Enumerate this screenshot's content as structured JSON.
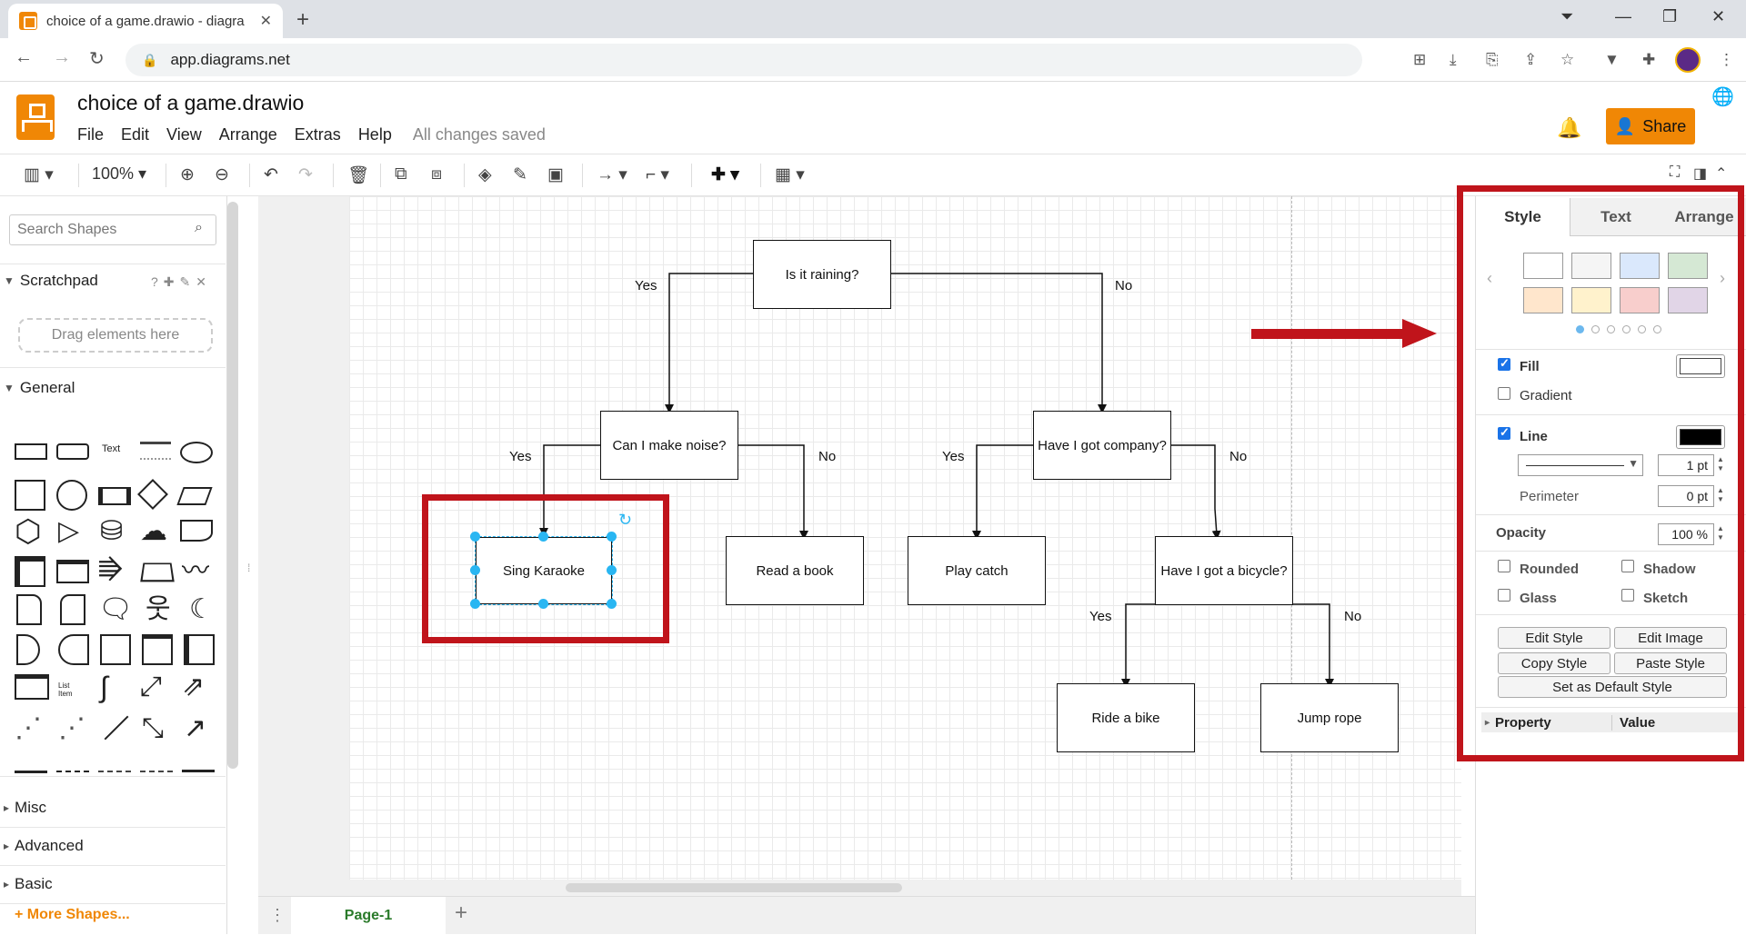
{
  "browser": {
    "tab_title": "choice of a game.drawio - diagra",
    "url": "app.diagrams.net"
  },
  "app": {
    "doc_title": "choice of a game.drawio",
    "menu": [
      "File",
      "Edit",
      "View",
      "Arrange",
      "Extras",
      "Help"
    ],
    "save_status": "All changes saved",
    "share_label": "Share"
  },
  "toolbar": {
    "zoom": "100%"
  },
  "sidebar": {
    "search_placeholder": "Search Shapes",
    "scratchpad": "Scratchpad",
    "drag_hint": "Drag elements here",
    "general": "General",
    "shape_text_label": "Text",
    "list_item_label": "List Item",
    "sections": [
      "Misc",
      "Advanced",
      "Basic"
    ],
    "more_shapes": "+ More Shapes..."
  },
  "diagram": {
    "nodes": {
      "raining": "Is it raining?",
      "noise": "Can I make noise?",
      "company": "Have I got company?",
      "karaoke": "Sing Karaoke",
      "book": "Read a book",
      "catch": "Play catch",
      "bicycle": "Have I got a bicycle?",
      "bike": "Ride a bike",
      "rope": "Jump rope"
    },
    "edge_labels": {
      "raining_yes": "Yes",
      "raining_no": "No",
      "noise_yes": "Yes",
      "noise_no": "No",
      "company_yes": "Yes",
      "company_no": "No",
      "bicycle_yes": "Yes",
      "bicycle_no": "No"
    }
  },
  "pages": {
    "active": "Page-1"
  },
  "format_panel": {
    "tabs": [
      "Style",
      "Text",
      "Arrange"
    ],
    "swatch_colors": [
      "#ffffff",
      "#f5f5f5",
      "#dae8fc",
      "#d5e8d4",
      "#ffe6cc",
      "#fff2cc",
      "#f8cecc",
      "#e1d5e7"
    ],
    "fill": "Fill",
    "gradient": "Gradient",
    "line": "Line",
    "line_width": "1 pt",
    "perimeter": "Perimeter",
    "perimeter_value": "0 pt",
    "opacity": "Opacity",
    "opacity_value": "100 %",
    "rounded": "Rounded",
    "shadow": "Shadow",
    "glass": "Glass",
    "sketch": "Sketch",
    "edit_style": "Edit Style",
    "edit_image": "Edit Image",
    "copy_style": "Copy Style",
    "paste_style": "Paste Style",
    "set_default": "Set as Default Style",
    "property": "Property",
    "value": "Value",
    "fill_checked": true,
    "gradient_checked": false,
    "line_checked": true
  },
  "colors": {
    "accent": "#f08705",
    "selection": "#29b6f2",
    "annotation_red": "#c0141b"
  }
}
